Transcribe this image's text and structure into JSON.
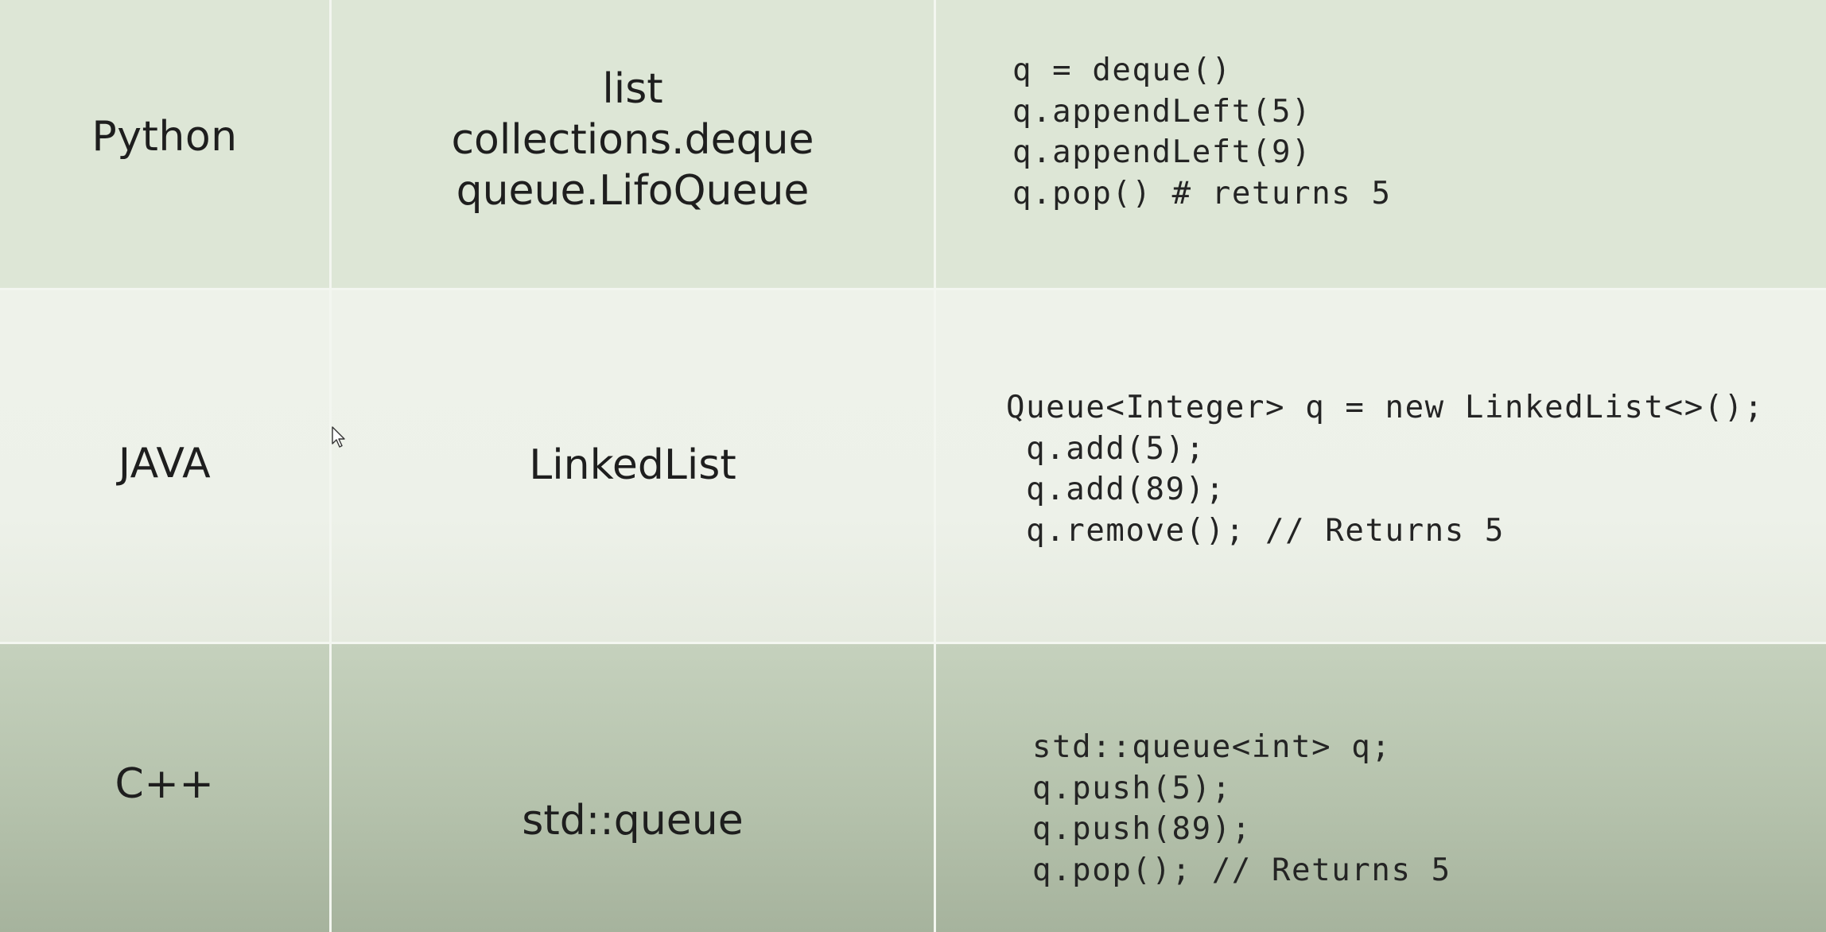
{
  "rows": [
    {
      "language": "Python",
      "implementations": [
        "list",
        "collections.deque",
        "queue.LifoQueue"
      ],
      "code": [
        "q = deque()",
        "q.appendLeft(5)",
        "q.appendLeft(9)",
        "q.pop() # returns 5"
      ]
    },
    {
      "language": "JAVA",
      "implementations": [
        "LinkedList"
      ],
      "code": [
        "Queue<Integer> q = new LinkedList<>();",
        " q.add(5);",
        " q.add(89);",
        " q.remove(); // Returns 5"
      ]
    },
    {
      "language": "C++",
      "implementations": [
        "std::queue"
      ],
      "code": [
        "std::queue<int> q;",
        "q.push(5);",
        "q.push(89);",
        "q.pop(); // Returns 5"
      ]
    }
  ],
  "cursor_icon": "mouse-pointer-icon"
}
